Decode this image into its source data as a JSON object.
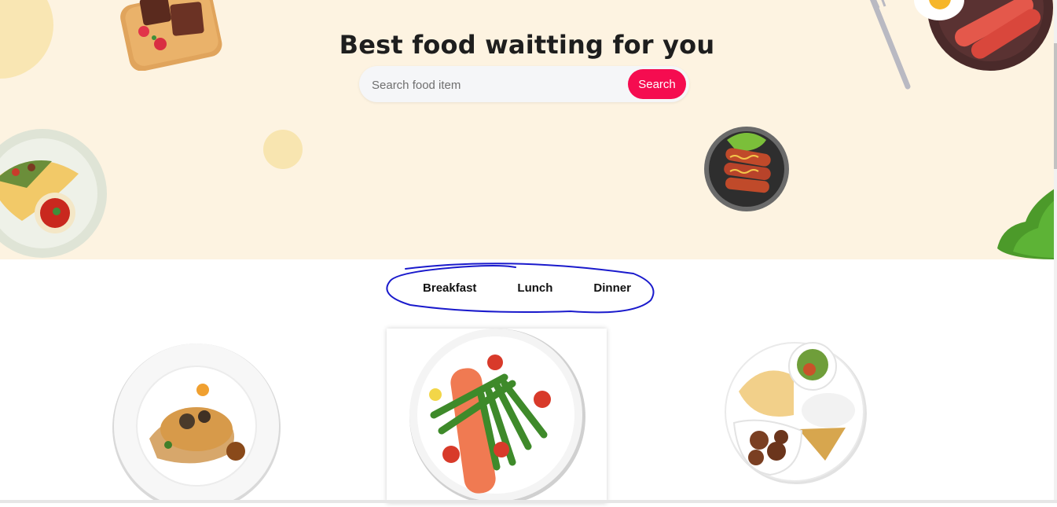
{
  "hero": {
    "title": "Best food waitting for you",
    "search": {
      "placeholder": "Search food item",
      "value": "",
      "button_label": "Search"
    }
  },
  "tabs": [
    {
      "label": "Breakfast"
    },
    {
      "label": "Lunch"
    },
    {
      "label": "Dinner"
    }
  ],
  "colors": {
    "hero_bg": "#fdf3e1",
    "accent": "#f50c50",
    "scribble": "#1a1acc"
  },
  "food_cards": [
    {
      "icon": "salmon-with-sauce-plate-icon",
      "selected": false
    },
    {
      "icon": "salmon-asparagus-plate-icon",
      "selected": true
    },
    {
      "icon": "curry-rice-platter-icon",
      "selected": false
    }
  ]
}
